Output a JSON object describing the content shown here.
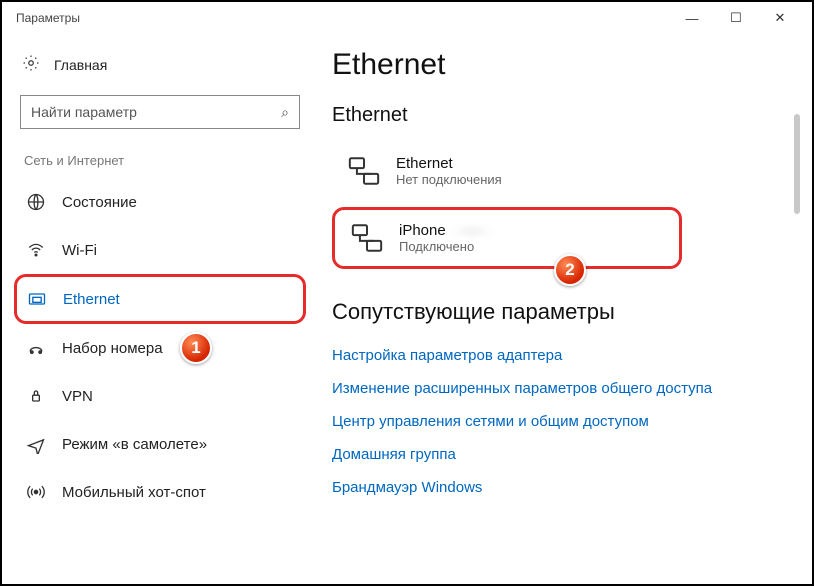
{
  "window": {
    "title": "Параметры"
  },
  "sidebar": {
    "home": "Главная",
    "search_placeholder": "Найти параметр",
    "category": "Сеть и Интернет",
    "items": [
      {
        "label": "Состояние"
      },
      {
        "label": "Wi-Fi"
      },
      {
        "label": "Ethernet",
        "selected": true
      },
      {
        "label": "Набор номера"
      },
      {
        "label": "VPN"
      },
      {
        "label": "Режим «в самолете»"
      },
      {
        "label": "Мобильный хот-спот"
      }
    ]
  },
  "main": {
    "title": "Ethernet",
    "section": "Ethernet",
    "connections": [
      {
        "name": "Ethernet",
        "status": "Нет подключения",
        "highlight": false
      },
      {
        "name": "iPhone",
        "status": "Подключено",
        "highlight": true
      }
    ],
    "related_title": "Сопутствующие параметры",
    "related_links": [
      "Настройка параметров адаптера",
      "Изменение расширенных параметров общего доступа",
      "Центр управления сетями и общим доступом",
      "Домашняя группа",
      "Брандмауэр Windows"
    ]
  },
  "markers": {
    "m1": "1",
    "m2": "2"
  }
}
